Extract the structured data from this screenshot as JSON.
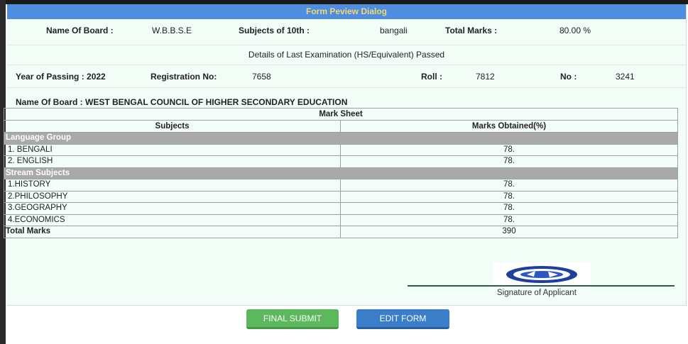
{
  "dialog": {
    "title": "Form Peview Dialog"
  },
  "board10": {
    "board_label": "Name Of Board :",
    "board_value": "W.B.B.S.E",
    "subjects_label": "Subjects of 10th :",
    "subjects_value": "bangali",
    "total_label": "Total Marks :",
    "total_value": "80.00 %"
  },
  "section_heading": "Details of Last Examination (HS/Equivalent) Passed",
  "exam": {
    "year_label": "Year of Passing : 2022",
    "reg_label": "Registration No:",
    "reg_value": "7658",
    "roll_label": "Roll :",
    "roll_value": "7812",
    "no_label": "No :",
    "no_value": "3241"
  },
  "board12": "Name Of Board : WEST BENGAL COUNCIL OF HIGHER SECONDARY EDUCATION",
  "marksheet": {
    "title": "Mark Sheet",
    "col_subjects": "Subjects",
    "col_marks": "Marks Obtained(%)",
    "group1": "Language Group",
    "lang": [
      {
        "subject": "1. BENGALI",
        "marks": "78."
      },
      {
        "subject": "2. ENGLISH",
        "marks": "78."
      }
    ],
    "group2": "Stream Subjects",
    "stream": [
      {
        "subject": "1.HISTORY",
        "marks": "78."
      },
      {
        "subject": "2.PHILOSOPHY",
        "marks": "78."
      },
      {
        "subject": "3.GEOGRAPHY",
        "marks": "78."
      },
      {
        "subject": "4.ECONOMICS",
        "marks": "78."
      }
    ],
    "total_label": "Total Marks",
    "total_value": "390"
  },
  "signature": {
    "label": "Signature of Applicant"
  },
  "buttons": {
    "submit": "FINAL SUBMIT",
    "edit": "EDIT FORM"
  },
  "colors": {
    "title_bar": "#4f8de0",
    "title_text": "#f4d86a",
    "submit": "#5cb85c",
    "edit": "#3a7dc9",
    "group_row": "#a9a9a9"
  }
}
